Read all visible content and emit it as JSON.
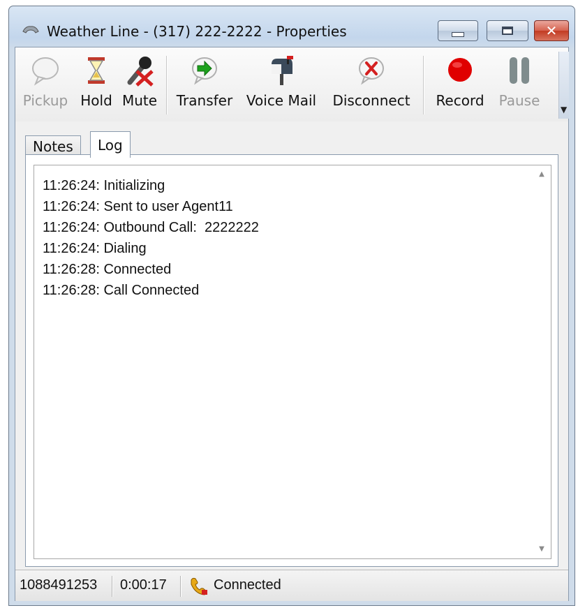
{
  "window": {
    "title": "Weather Line - (317) 222-2222 - Properties"
  },
  "toolbar": {
    "buttons": [
      {
        "label": "Pickup",
        "icon": "speech-bubble-icon",
        "enabled": false
      },
      {
        "label": "Hold",
        "icon": "hourglass-icon",
        "enabled": true
      },
      {
        "label": "Mute",
        "icon": "microphone-muted-icon",
        "enabled": true
      },
      {
        "label": "Transfer",
        "icon": "transfer-arrow-icon",
        "enabled": true
      },
      {
        "label": "Voice Mail",
        "icon": "mailbox-icon",
        "enabled": true
      },
      {
        "label": "Disconnect",
        "icon": "disconnect-icon",
        "enabled": true
      },
      {
        "label": "Record",
        "icon": "record-dot-icon",
        "enabled": true
      },
      {
        "label": "Pause",
        "icon": "pause-icon",
        "enabled": false
      }
    ]
  },
  "tabs": [
    {
      "label": "Notes",
      "selected": false
    },
    {
      "label": "Log",
      "selected": true
    }
  ],
  "log": {
    "lines": [
      "11:26:24: Initializing",
      "11:26:24: Sent to user Agent11",
      "11:26:24: Outbound Call:  2222222",
      "11:26:24: Dialing",
      "11:26:28: Connected",
      "11:26:28: Call Connected"
    ]
  },
  "status": {
    "call_id": "1088491253",
    "duration": "0:00:17",
    "state": "Connected"
  },
  "colors": {
    "record": "#e00000",
    "transfer_arrow": "#1ea21e",
    "disconnect_x": "#d42020",
    "close_button": "#c23b22"
  }
}
